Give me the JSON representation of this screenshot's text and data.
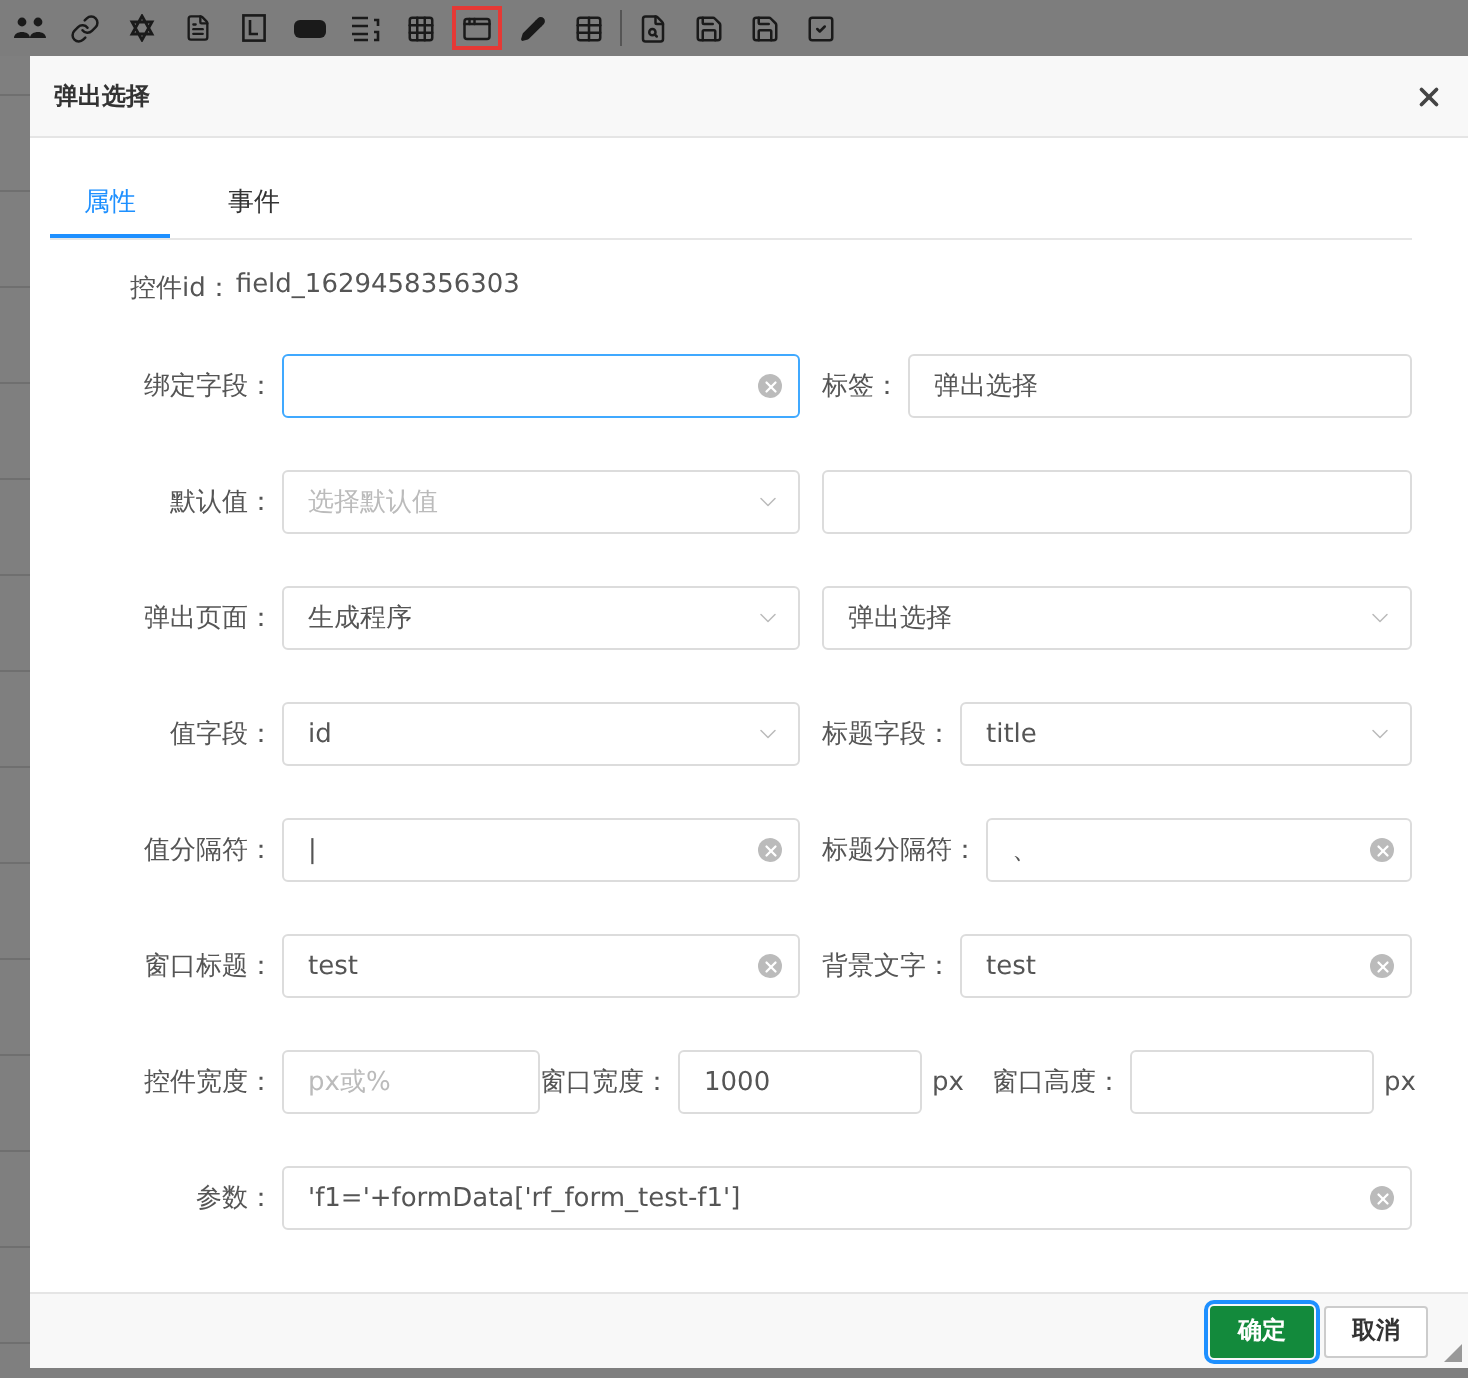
{
  "toolbar": {
    "items": [
      {
        "selected": false
      },
      {
        "selected": false
      },
      {
        "selected": false
      },
      {
        "selected": false
      },
      {
        "selected": false
      },
      {
        "selected": false
      },
      {
        "selected": false
      },
      {
        "selected": false
      },
      {
        "selected": true
      },
      {
        "selected": false
      },
      {
        "selected": false
      },
      {
        "selected": false
      },
      {
        "selected": false
      },
      {
        "selected": false
      },
      {
        "selected": false
      }
    ]
  },
  "dialog": {
    "title": "弹出选择",
    "tabs": [
      {
        "label": "属性",
        "selected": true
      },
      {
        "label": "事件",
        "selected": false
      }
    ],
    "id_line": {
      "label": "控件id：",
      "value": "field_1629458356303"
    },
    "rows": [
      {
        "kind": "pair",
        "items": [
          {
            "label": "绑定字段：",
            "kind": "input",
            "value": "",
            "clearable": true,
            "focused": true
          },
          {
            "label": "标签：",
            "kind": "input",
            "value": "弹出选择",
            "clearable": false,
            "focused": false
          }
        ]
      },
      {
        "kind": "pair",
        "items": [
          {
            "label": "默认值：",
            "kind": "select",
            "placeholder": "选择默认值",
            "focused": false
          },
          {
            "kind": "input",
            "value": "",
            "clearable": false,
            "focused": false
          }
        ]
      },
      {
        "kind": "pair",
        "items": [
          {
            "label": "弹出页面：",
            "kind": "select",
            "value": "生成程序",
            "focused": false
          },
          {
            "kind": "select",
            "value": "弹出选择",
            "focused": false
          }
        ]
      },
      {
        "kind": "pair",
        "items": [
          {
            "label": "值字段：",
            "kind": "select",
            "value": "id",
            "focused": false
          },
          {
            "label": "标题字段：",
            "kind": "select",
            "value": "title",
            "focused": false
          }
        ]
      },
      {
        "kind": "pair",
        "items": [
          {
            "label": "值分隔符：",
            "kind": "input",
            "value": "|",
            "clearable": true,
            "focused": false
          },
          {
            "label": "标题分隔符：",
            "kind": "input",
            "value": "、",
            "clearable": true,
            "focused": false
          }
        ]
      },
      {
        "kind": "pair",
        "items": [
          {
            "label": "窗口标题：",
            "kind": "input",
            "value": "test",
            "clearable": true,
            "focused": false
          },
          {
            "label": "背景文字：",
            "kind": "input",
            "value": "test",
            "clearable": true,
            "focused": false
          }
        ]
      },
      {
        "kind": "sizes",
        "items": [
          {
            "label": "控件宽度：",
            "kind": "input",
            "placeholder": "px或%",
            "clearable": false,
            "focused": false
          },
          {
            "label": "窗口宽度：",
            "kind": "input",
            "value": "1000",
            "unit": "px",
            "clearable": false,
            "focused": false
          },
          {
            "label": "窗口高度：",
            "kind": "input",
            "value": "",
            "unit": "px",
            "clearable": false,
            "focused": false
          }
        ]
      },
      {
        "kind": "full",
        "items": [
          {
            "label": "参数：",
            "kind": "input",
            "value": "'f1='+formData['rf_form_test-f1']",
            "clearable": true,
            "focused": false
          }
        ]
      }
    ],
    "buttons": [
      {
        "label": "确定",
        "kind": "primary",
        "focused": true
      },
      {
        "label": "取消",
        "kind": "default",
        "focused": false
      }
    ]
  }
}
